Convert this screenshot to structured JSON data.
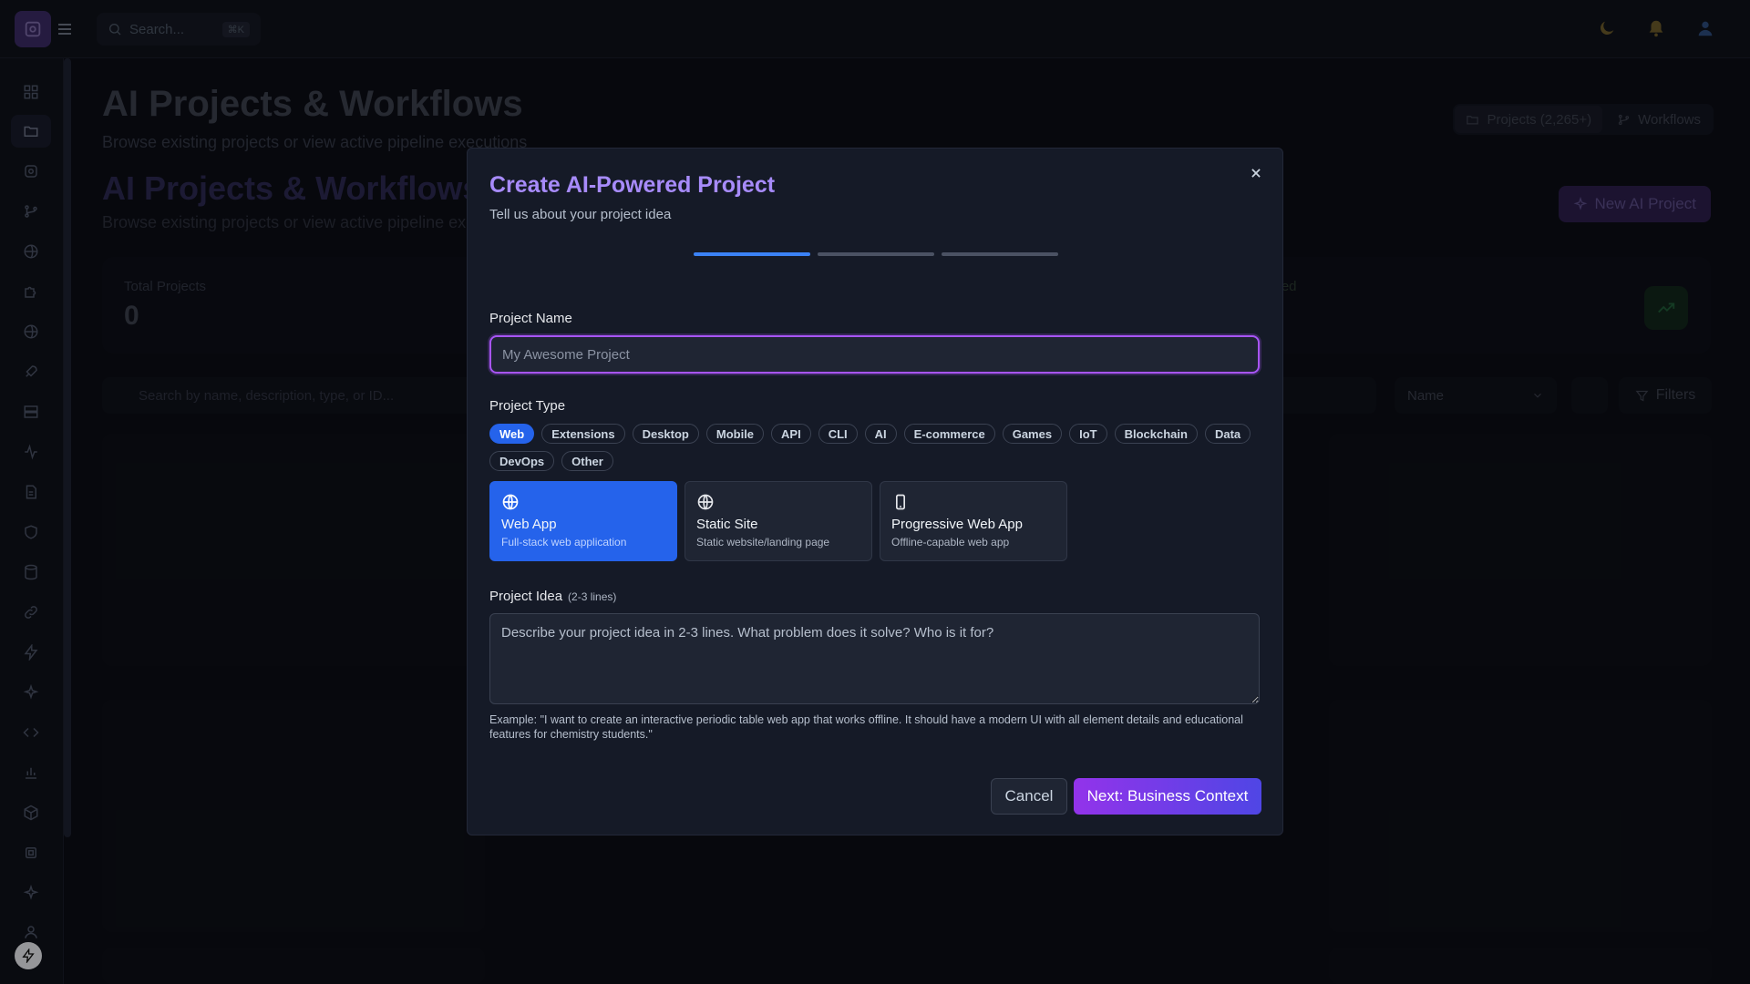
{
  "topbar": {
    "search_placeholder": "Search...",
    "search_shortcut": "⌘K",
    "icons": [
      "menu-icon",
      "search-icon",
      "moon-icon",
      "bell-icon",
      "user-icon"
    ]
  },
  "sidebar": {
    "icons": [
      "dashboard-icon",
      "folder-icon",
      "settings-icon",
      "git-branch-icon",
      "globe-icon",
      "puzzle-icon",
      "globe-icon",
      "rocket-icon",
      "server-icon",
      "activity-icon",
      "file-icon",
      "shield-icon",
      "database-icon",
      "link-icon",
      "zap-icon",
      "sparkle-icon",
      "code-icon",
      "bar-chart-icon",
      "box-icon",
      "cpu-icon",
      "star-icon",
      "user-icon"
    ],
    "active": "folder-icon"
  },
  "page": {
    "title": "AI Projects & Workflows",
    "subtitle": "Browse existing projects or view active pipeline executions",
    "title_secondary": "AI Projects & Workflows",
    "subtitle_secondary": "Browse existing projects or view active pipeline execu",
    "tabs": [
      {
        "label": "Projects (2,265+)",
        "icon": "folder-icon",
        "active": true
      },
      {
        "label": "Workflows",
        "icon": "git-branch-icon",
        "active": false
      }
    ],
    "new_button": "New AI Project",
    "stats": {
      "total_label": "Total Projects",
      "total_value": "0",
      "partial_label": "nced"
    },
    "filters": {
      "search_placeholder": "Search by name, description, type, or ID...",
      "sort_value": "Name",
      "filters_label": "Filters"
    }
  },
  "modal": {
    "title": "Create AI-Powered Project",
    "subtitle": "Tell us about your project idea",
    "steps_total": 3,
    "step_current": 1,
    "project_name_label": "Project Name",
    "project_name_placeholder": "My Awesome Project",
    "project_name_value": "",
    "project_type_label": "Project Type",
    "project_types": [
      "Web",
      "Extensions",
      "Desktop",
      "Mobile",
      "API",
      "CLI",
      "AI",
      "E-commerce",
      "Games",
      "IoT",
      "Blockchain",
      "Data",
      "DevOps",
      "Other"
    ],
    "selected_type": "Web",
    "subtypes": [
      {
        "title": "Web App",
        "desc": "Full-stack web application",
        "icon": "globe-icon",
        "selected": true
      },
      {
        "title": "Static Site",
        "desc": "Static website/landing page",
        "icon": "globe-icon",
        "selected": false
      },
      {
        "title": "Progressive Web App",
        "desc": "Offline-capable web app",
        "icon": "smartphone-icon",
        "selected": false
      }
    ],
    "idea_label": "Project Idea",
    "idea_hint": "(2-3 lines)",
    "idea_placeholder": "Describe your project idea in 2-3 lines. What problem does it solve? Who is it for?",
    "example": "Example: \"I want to create an interactive periodic table web app that works offline. It should have a modern UI with all element details and educational features for chemistry students.\"",
    "cancel_label": "Cancel",
    "next_label": "Next: Business Context"
  },
  "colors": {
    "accent_purple": "#a855f7",
    "accent_blue": "#2563eb",
    "title_purple": "#a78bfa",
    "modal_bg": "#151a27"
  }
}
